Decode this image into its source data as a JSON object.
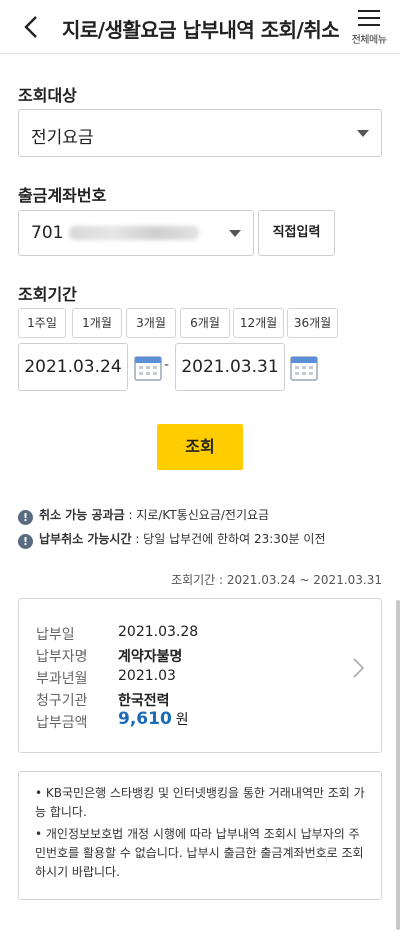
{
  "header": {
    "title": "지로/생활요금 납부내역 조회/취소",
    "menu_label": "전체메뉴"
  },
  "target": {
    "label": "조회대상",
    "value": "전기요금"
  },
  "account": {
    "label": "출금계좌번호",
    "value_prefix": "701",
    "direct_input_label": "직접입력"
  },
  "period": {
    "label": "조회기간",
    "options": [
      "1주일",
      "1개월",
      "3개월",
      "6개월",
      "12개월",
      "36개월"
    ],
    "start_date": "2021.03.24",
    "end_date": "2021.03.31",
    "separator": "-"
  },
  "search_button": "조회",
  "notices": [
    {
      "title": "취소 가능 공과금",
      "text": " : 지로/KT통신요금/전기요금"
    },
    {
      "title": "납부취소 가능시간",
      "text": " : 당일 납부건에 한하여 23:30분 이전"
    }
  ],
  "range_text": "조회기간 : 2021.03.24 ~ 2021.03.31",
  "result": {
    "rows": [
      {
        "key": "납부일",
        "value": "2021.03.28"
      },
      {
        "key": "납부자명",
        "value": "계약자불명"
      },
      {
        "key": "부과년월",
        "value": "2021.03"
      },
      {
        "key": "청구기관",
        "value": "한국전력"
      },
      {
        "key": "납부금액",
        "value": "9,610"
      }
    ],
    "currency": "원"
  },
  "info": [
    "• KB국민은행 스타뱅킹 및 인터넷뱅킹을 통한 거래내역만 조회 가능 합니다.",
    "• 개인정보보호법 개정 시행에 따라 납부내역 조회시 납부자의 주민번호를 활용할 수 없습니다. 납부시 출금한 출금계좌번호로 조회하시기 바랍니다."
  ],
  "colors": {
    "accent": "#ffcc00",
    "amount": "#1a6bb8",
    "notice_icon": "#5a6b80"
  }
}
